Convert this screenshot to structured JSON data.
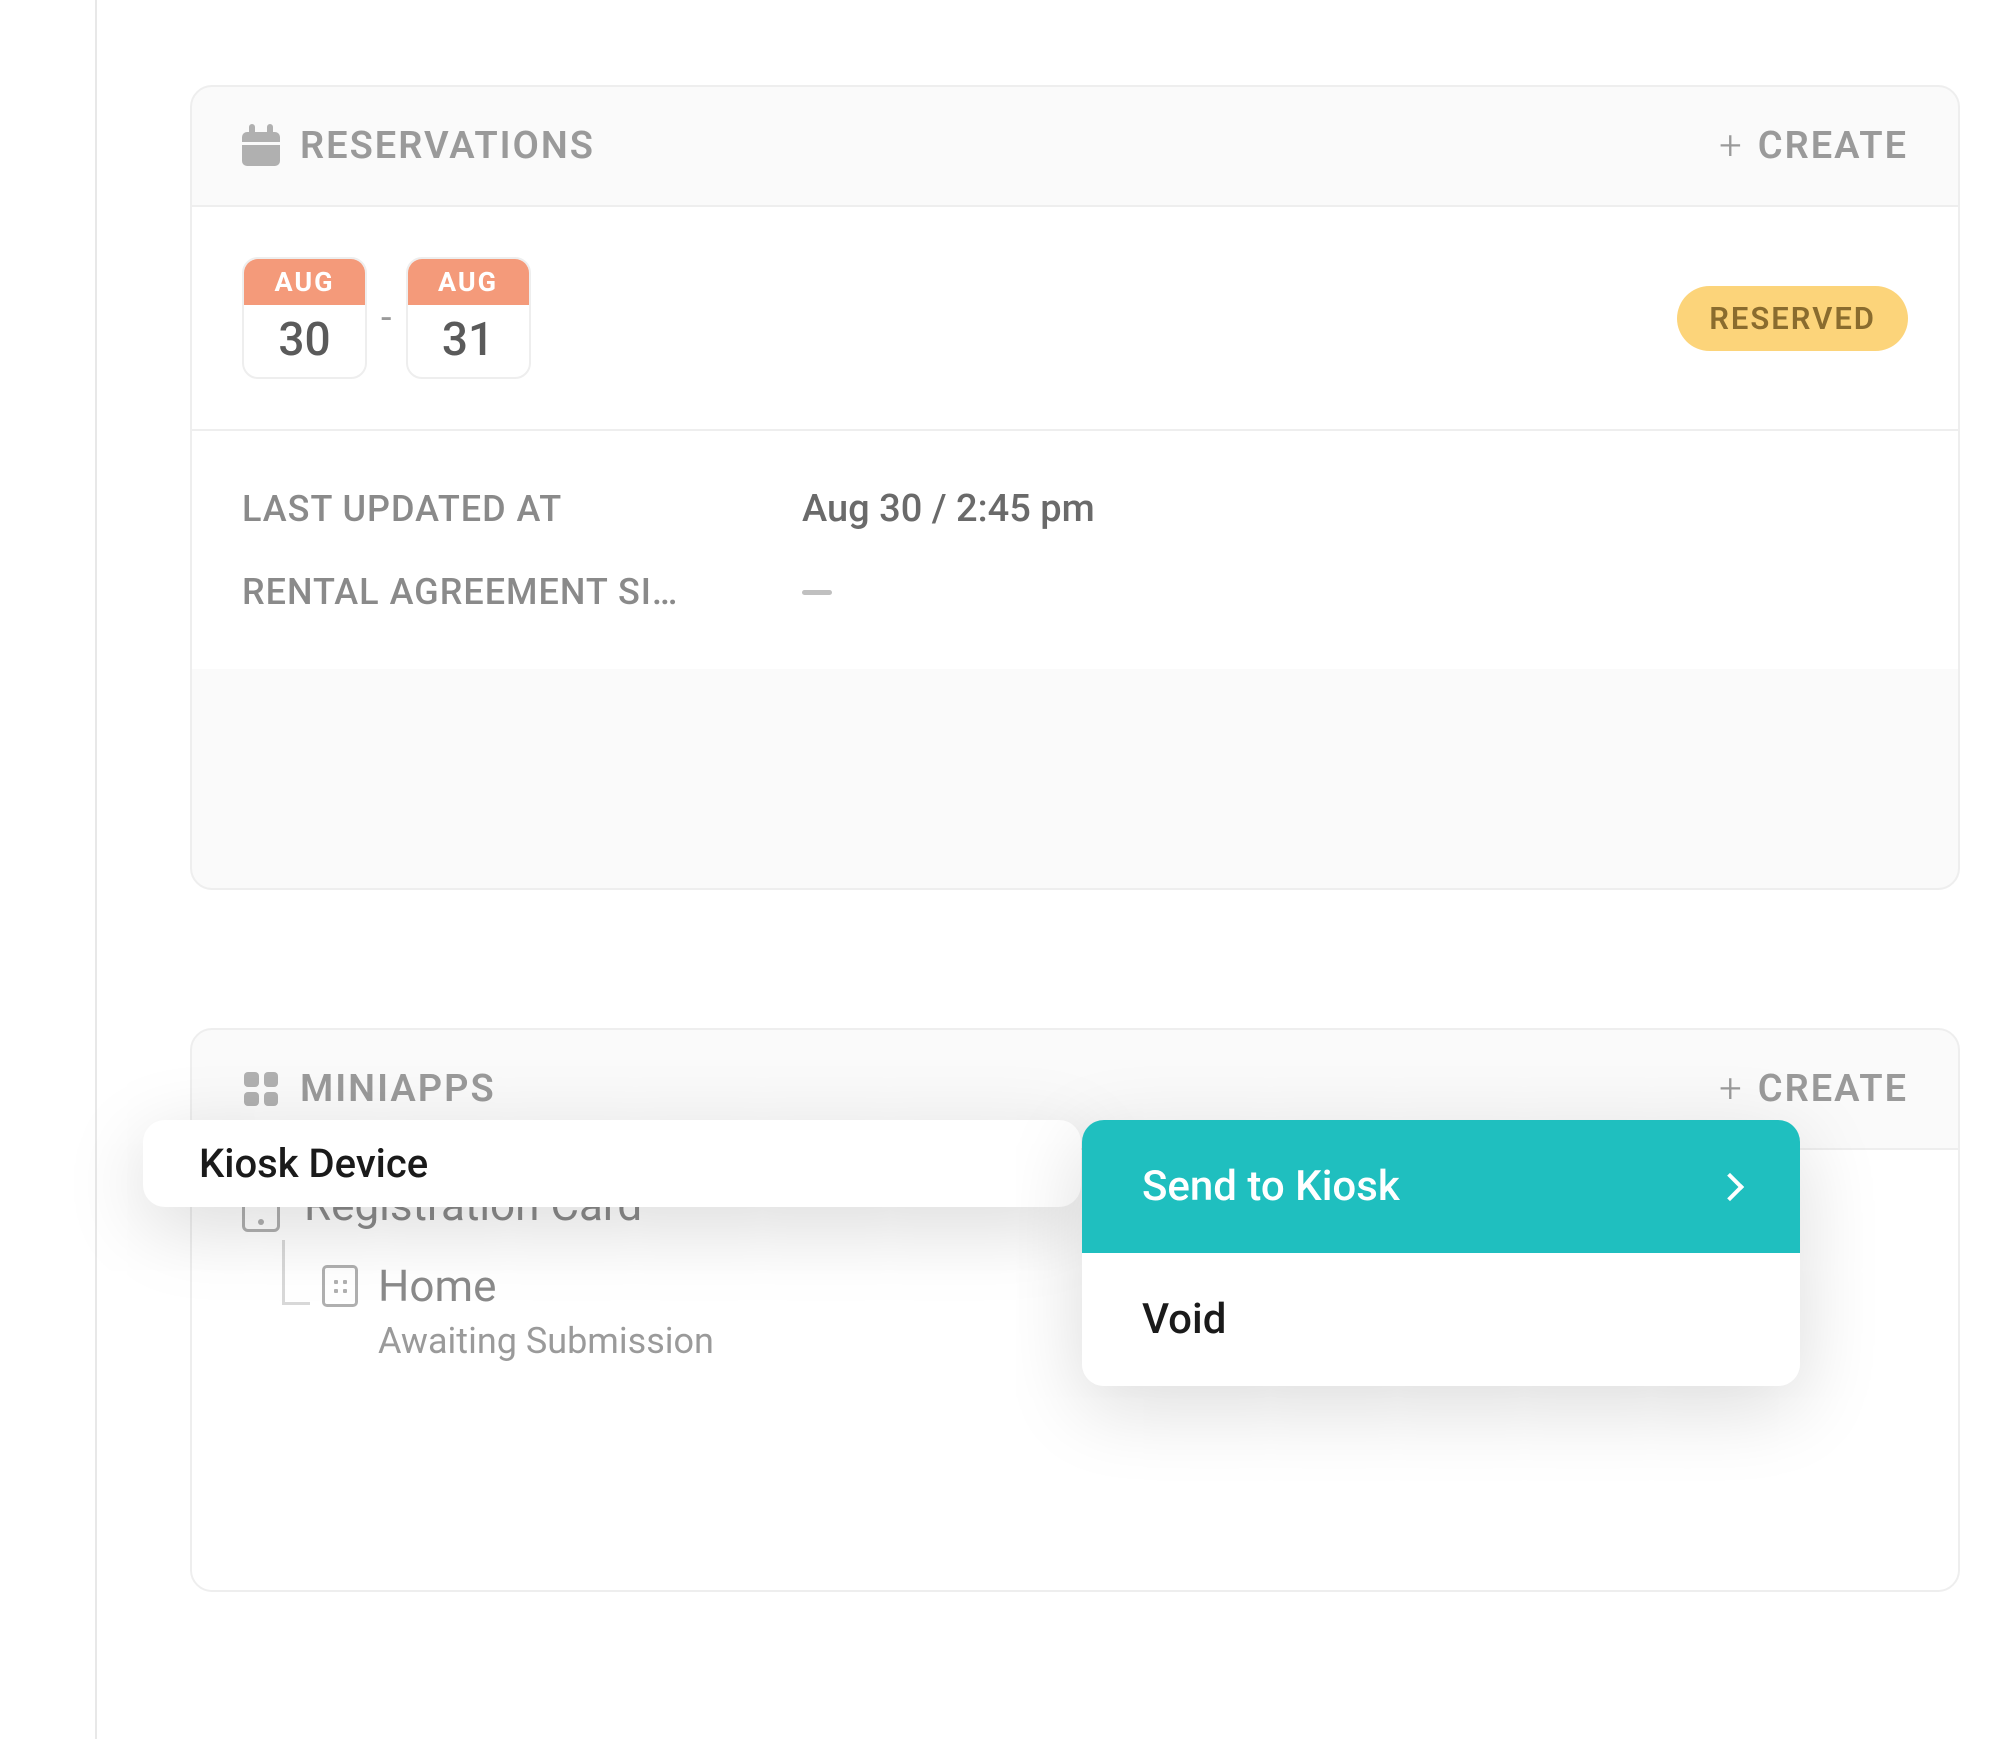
{
  "reservations": {
    "title": "RESERVATIONS",
    "createLabel": "CREATE",
    "startMonth": "AUG",
    "startDay": "30",
    "endMonth": "AUG",
    "endDay": "31",
    "dash": "-",
    "statusLabel": "RESERVED",
    "details": {
      "lastUpdatedLabel": "LAST UPDATED AT",
      "lastUpdatedValue": "Aug 30 / 2:45 pm",
      "rentalAgreementLabel": "RENTAL AGREEMENT SI…"
    }
  },
  "miniapps": {
    "title": "MINIAPPS",
    "createLabel": "CREATE",
    "appTitle": "Registration Card",
    "childTitle": "Home",
    "childStatus": "Awaiting Submission"
  },
  "popup": {
    "label": "Kiosk Device"
  },
  "menu": {
    "sendToKiosk": "Send to Kiosk",
    "void": "Void"
  },
  "colors": {
    "accent": "#1fbfbf",
    "dateChipHeader": "#f49a7a",
    "badgeBg": "#fcd47a",
    "badgeText": "#8a6c2e",
    "muted": "#9a9a9a"
  }
}
